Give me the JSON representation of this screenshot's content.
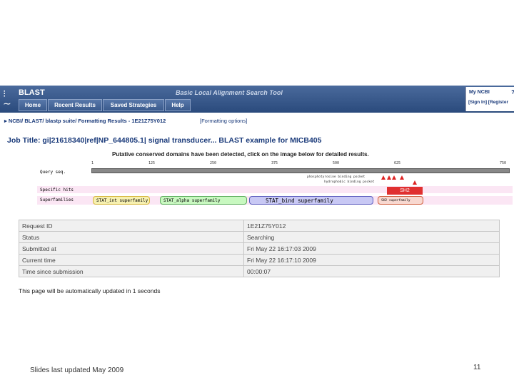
{
  "header": {
    "app_name": "BLAST",
    "subtitle": "Basic Local Alignment Search Tool",
    "nav": [
      "Home",
      "Recent Results",
      "Saved Strategies",
      "Help"
    ],
    "account_title": "My NCBI",
    "account_mark": "?",
    "account_links": "[Sign In] [Register"
  },
  "breadcrumb": "▸ NCBI/ BLAST/ blastp suite/ Formatting Results - 1E21Z75Y012",
  "format_options": "[Formatting options]",
  "job_title": "Job Title: gi|21618340|ref|NP_644805.1| signal transducer... BLAST example for MICB405",
  "domains": {
    "heading": "Putative conserved domains have been detected, click on the image below for detailed results.",
    "ticks": [
      "1",
      "125",
      "250",
      "375",
      "500",
      "625",
      "750"
    ],
    "labels": {
      "query": "Query seq.",
      "specific": "Specific hits",
      "superfamilies": "Superfamilies"
    },
    "site_labels": [
      "phosphotyrosine binding pocket",
      "hydrophobic binding pocket"
    ],
    "specific_hit": "SH2",
    "superfamily_boxes": [
      {
        "label": "STAT_int superfamily",
        "color": "#f6f0b0",
        "border": "#d8b840"
      },
      {
        "label": "STAT_alpha superfamily",
        "color": "#c8f8c0",
        "border": "#60b060"
      },
      {
        "label": "STAT_bind superfamily",
        "color": "#c8c8f4",
        "border": "#6060c0"
      },
      {
        "label": "SH2 superfamily",
        "color": "#f8d8d0",
        "border": "#d06040"
      }
    ]
  },
  "status": [
    {
      "key": "Request ID",
      "value": "1E21Z75Y012"
    },
    {
      "key": "Status",
      "value": "Searching"
    },
    {
      "key": "Submitted at",
      "value": "Fri May 22 16:17:03 2009"
    },
    {
      "key": "Current time",
      "value": "Fri May 22 16:17:10 2009"
    },
    {
      "key": "Time since submission",
      "value": "00:00:07"
    }
  ],
  "auto_update": "This page will be automatically updated in 1 seconds",
  "footer_note": "Slides last updated May 2009",
  "page_number": "11"
}
